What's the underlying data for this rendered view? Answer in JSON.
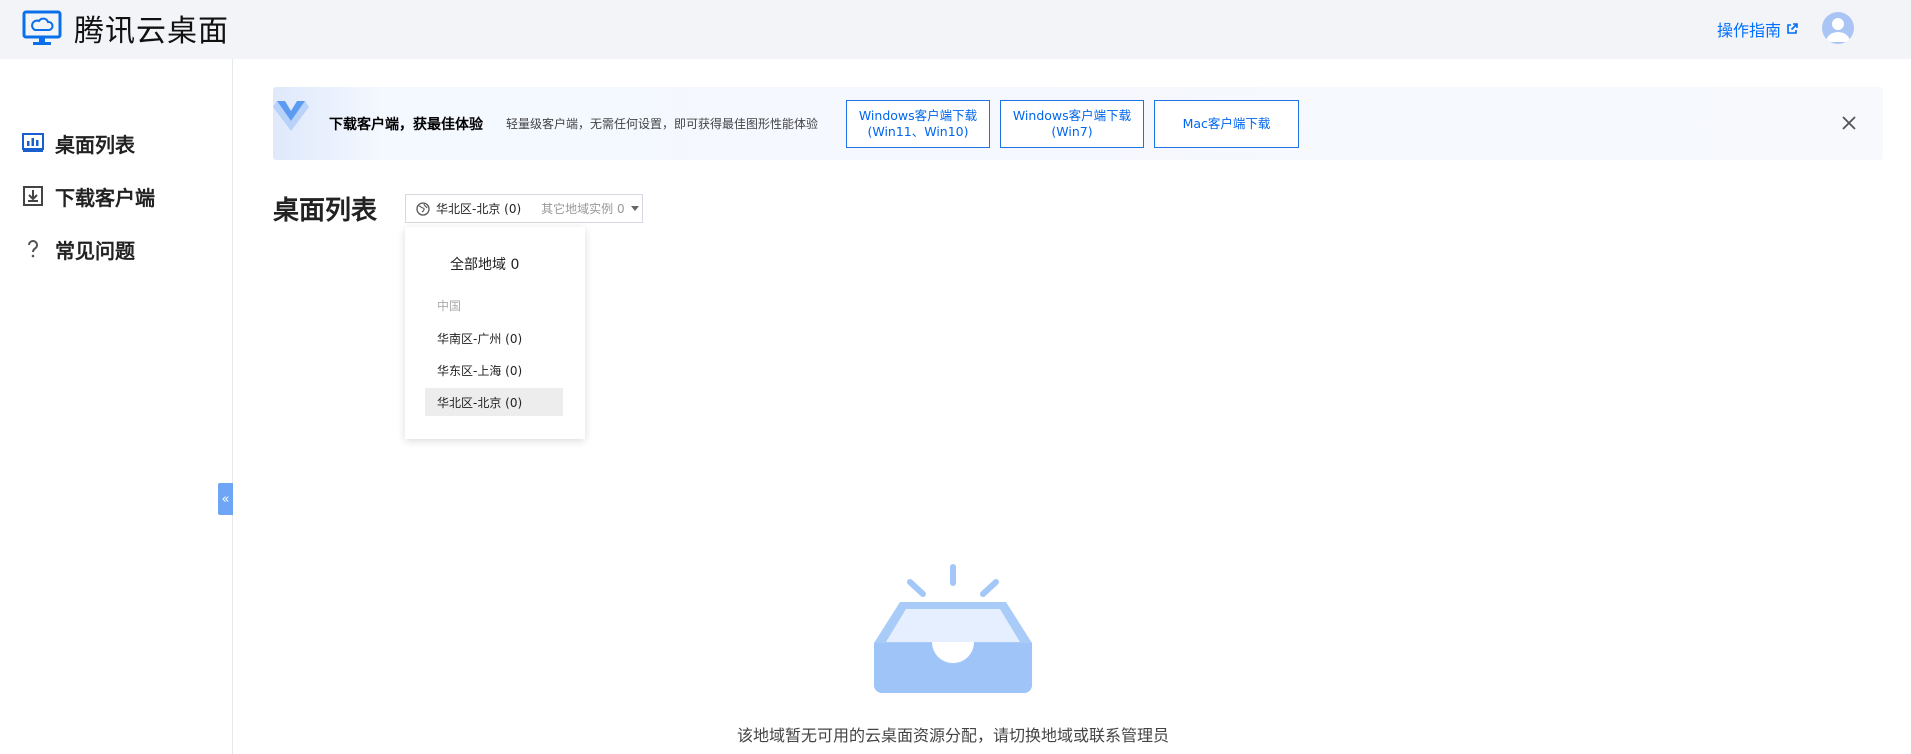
{
  "header": {
    "brand_name": "腾讯云桌面",
    "guide_label": "操作指南"
  },
  "sidebar": {
    "items": [
      {
        "label": "桌面列表"
      },
      {
        "label": "下载客户端"
      },
      {
        "label": "常见问题"
      }
    ],
    "collapse_glyph": "«"
  },
  "banner": {
    "title": "下载客户端，获最佳体验",
    "description": "轻量级客户端，无需任何设置，即可获得最佳图形性能体验",
    "buttons": [
      {
        "label": "Windows客户端下载\n(Win11、Win10)"
      },
      {
        "label": "Windows客户端下载\n(Win7)"
      },
      {
        "label": "Mac客户端下载"
      }
    ]
  },
  "main": {
    "title": "桌面列表",
    "region_select": {
      "current": "华北区-北京 (0)",
      "others": "其它地域实例 0"
    },
    "dropdown": {
      "all": "全部地域 0",
      "group": "中国",
      "items": [
        {
          "label": "华南区-广州 (0)"
        },
        {
          "label": "华东区-上海 (0)"
        },
        {
          "label": "华北区-北京 (0)"
        }
      ],
      "selected": "华北区-北京 (0)"
    },
    "empty_message": "该地域暂无可用的云桌面资源分配，请切换地域或联系管理员"
  },
  "colors": {
    "accent": "#006eff",
    "header_bg": "#f3f4f7",
    "collapse_bg": "#6ea6f5",
    "illustration": "#a3c7f7"
  },
  "icons": {
    "brand": "monitor-cloud-icon",
    "guide": "external-link-icon",
    "avatar": "user-avatar-icon",
    "nav_desktop_list": "desktop-list-icon",
    "nav_download": "download-icon",
    "nav_faq": "question-icon",
    "banner": "download-arrow-icon",
    "close": "close-icon",
    "region": "globe-icon",
    "empty": "empty-inbox-icon"
  }
}
